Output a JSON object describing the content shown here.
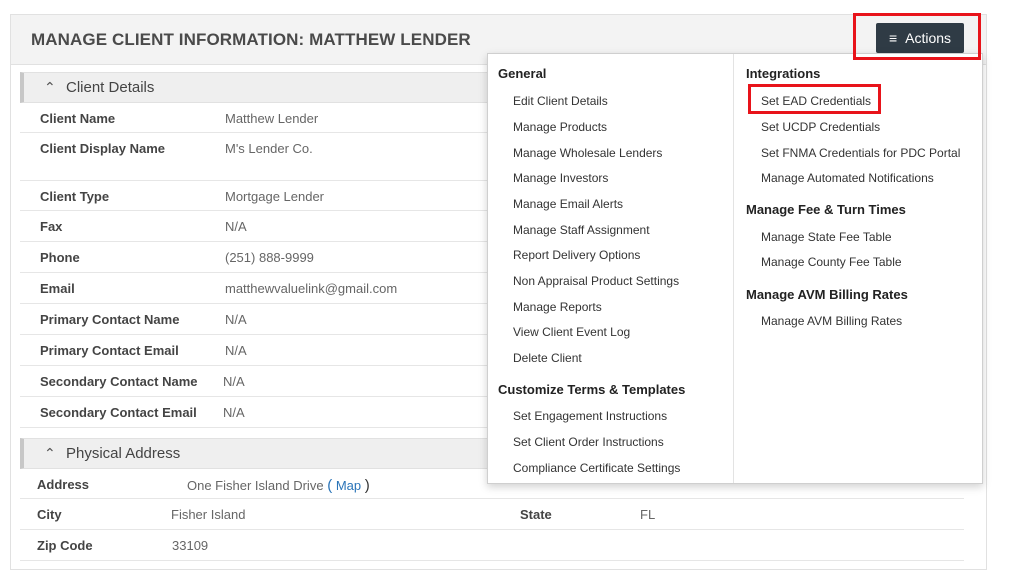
{
  "header": {
    "title": "MANAGE CLIENT INFORMATION: MATTHEW LENDER",
    "actions_label": "Actions",
    "actions_icon": "hamburger-menu-icon"
  },
  "client_details": {
    "section_title": "Client Details",
    "rows": [
      {
        "label": "Client Name",
        "value": "Matthew Lender"
      },
      {
        "label": "Client Display Name",
        "value": "M's Lender Co."
      },
      {
        "label": "Client Type",
        "value": "Mortgage Lender"
      },
      {
        "label": "Fax",
        "value": "N/A"
      },
      {
        "label": "Phone",
        "value": "(251) 888-9999"
      },
      {
        "label": "Email",
        "value": "matthewvaluelink@gmail.com"
      },
      {
        "label": "Primary Contact Name",
        "value": "N/A"
      },
      {
        "label": "Primary Contact Email",
        "value": "N/A"
      },
      {
        "label": "Secondary Contact Name",
        "value": "N/A"
      },
      {
        "label": "Secondary Contact Email",
        "value": "N/A"
      }
    ]
  },
  "physical_address": {
    "section_title": "Physical Address",
    "address_label": "Address",
    "address_value": "One Fisher Island Drive",
    "map_open": "(",
    "map_link": "Map",
    "map_close": ")",
    "city_label": "City",
    "city_value": "Fisher Island",
    "state_label": "State",
    "state_value": "FL",
    "zip_label": "Zip Code",
    "zip_value": "33109"
  },
  "actions_menu": {
    "general": {
      "heading": "General",
      "items": [
        "Edit Client Details",
        "Manage Products",
        "Manage Wholesale Lenders",
        "Manage Investors",
        "Manage Email Alerts",
        "Manage Staff Assignment",
        "Report Delivery Options",
        "Non Appraisal Product Settings",
        "Manage Reports",
        "View Client Event Log",
        "Delete Client"
      ]
    },
    "customize": {
      "heading": "Customize Terms & Templates",
      "items": [
        "Set Engagement Instructions",
        "Set Client Order Instructions",
        "Compliance Certificate Settings"
      ]
    },
    "integrations": {
      "heading": "Integrations",
      "items": [
        "Set EAD Credentials",
        "Set UCDP Credentials",
        "Set FNMA Credentials for PDC Portal",
        "Manage Automated Notifications"
      ]
    },
    "fee_turn_times": {
      "heading": "Manage Fee & Turn Times",
      "items": [
        "Manage State Fee Table",
        "Manage County Fee Table"
      ]
    },
    "avm": {
      "heading": "Manage AVM Billing Rates",
      "items": [
        "Manage AVM Billing Rates"
      ]
    }
  },
  "colors": {
    "highlight": "#e8131a",
    "button_bg": "#2f3b45",
    "link": "#2a74b8"
  }
}
